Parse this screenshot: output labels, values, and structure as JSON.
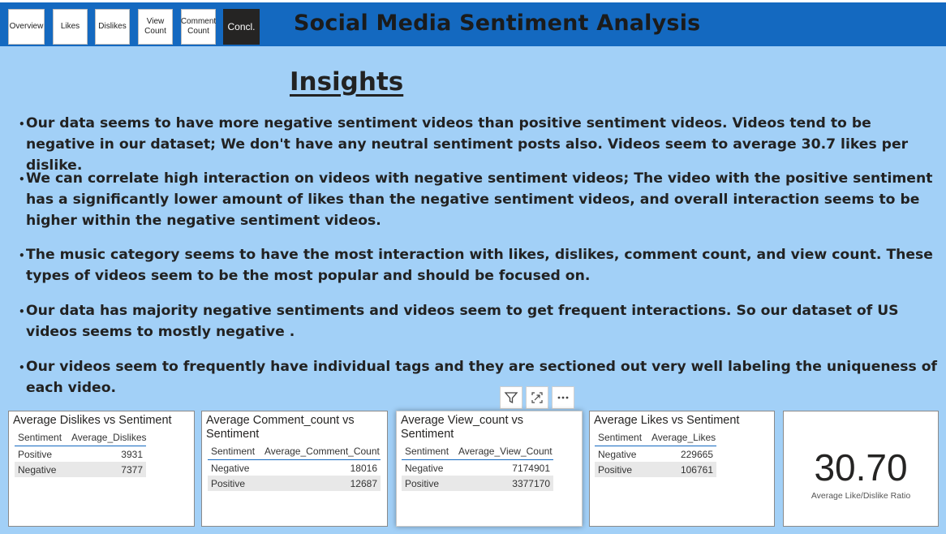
{
  "nav": {
    "buttons": [
      {
        "label": "Overview"
      },
      {
        "label": "Likes"
      },
      {
        "label": "Dislikes"
      },
      {
        "label": "View Count"
      },
      {
        "label": "Comment Count"
      },
      {
        "label": "Concl."
      }
    ],
    "active": "Concl."
  },
  "header": {
    "title": "Social Media Sentiment Analysis",
    "color": "#1469c0"
  },
  "insights": {
    "title": "Insights",
    "items": [
      "Our data seems to have more negative sentiment videos than positive sentiment videos. Videos tend to be negative in our dataset; We don't have any neutral sentiment posts also. Videos seem to average 30.7 likes per dislike.",
      "We can correlate high interaction on videos with negative sentiment videos; The video with the positive sentiment has a significantly lower amount of likes than the negative sentiment videos, and overall interaction seems to be higher within the negative sentiment videos.",
      "The music category seems to have the most interaction with likes, dislikes, comment count, and view count. These types of videos seem to be the most popular and should be focused on.",
      "Our data has majority negative sentiments and videos seem to get frequent interactions. So our dataset of US videos seems to mostly negative .",
      "Our videos seem to frequently have individual tags and they are sectioned out very well labeling the uniqueness of each video."
    ]
  },
  "toolbar": {
    "icons": [
      "filter-icon",
      "focus-mode-icon",
      "more-options-icon"
    ]
  },
  "cards": {
    "dislikes": {
      "title": "Average Dislikes vs Sentiment",
      "columns": [
        "Sentiment",
        "Average_Dislikes"
      ],
      "rows": [
        [
          "Positive",
          "3931"
        ],
        [
          "Negative",
          "7377"
        ]
      ]
    },
    "comments": {
      "title": "Average Comment_count vs Sentiment",
      "columns": [
        "Sentiment",
        "Average_Comment_Count"
      ],
      "rows": [
        [
          "Negative",
          "18016"
        ],
        [
          "Positive",
          "12687"
        ]
      ]
    },
    "views": {
      "title": "Average View_count vs Sentiment",
      "columns": [
        "Sentiment",
        "Average_View_Count"
      ],
      "rows": [
        [
          "Negative",
          "7174901"
        ],
        [
          "Positive",
          "3377170"
        ]
      ]
    },
    "likes": {
      "title": "Average Likes vs Sentiment",
      "columns": [
        "Sentiment",
        "Average_Likes"
      ],
      "rows": [
        [
          "Negative",
          "229665"
        ],
        [
          "Positive",
          "106761"
        ]
      ]
    },
    "kpi": {
      "value": "30.70",
      "label": "Average Like/Dislike Ratio"
    }
  }
}
